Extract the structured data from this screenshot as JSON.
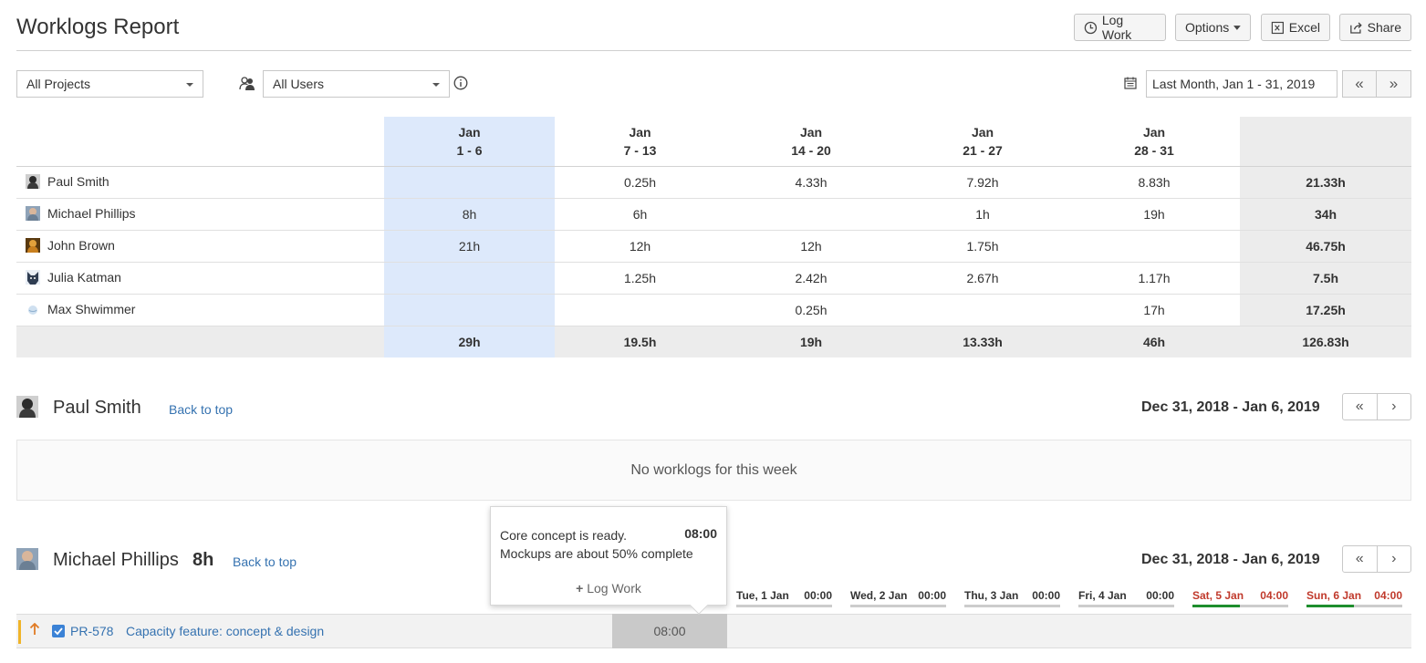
{
  "page": {
    "title": "Worklogs Report"
  },
  "toolbar": {
    "log_work": "Log Work",
    "options": "Options",
    "excel": "Excel",
    "share": "Share"
  },
  "filters": {
    "projects": "All Projects",
    "users": "All Users",
    "date_range": "Last Month, Jan 1 - 31, 2019",
    "prev": "«",
    "next": "»"
  },
  "summary": {
    "columns": [
      {
        "month": "Jan",
        "range": "1 - 6"
      },
      {
        "month": "Jan",
        "range": "7 - 13"
      },
      {
        "month": "Jan",
        "range": "14 - 20"
      },
      {
        "month": "Jan",
        "range": "21 - 27"
      },
      {
        "month": "Jan",
        "range": "28 - 31"
      }
    ],
    "rows": [
      {
        "name": "Paul Smith",
        "cells": [
          "",
          "0.25h",
          "4.33h",
          "7.92h",
          "8.83h"
        ],
        "total": "21.33h"
      },
      {
        "name": "Michael Phillips",
        "cells": [
          "8h",
          "6h",
          "",
          "1h",
          "19h"
        ],
        "total": "34h"
      },
      {
        "name": "John Brown",
        "cells": [
          "21h",
          "12h",
          "12h",
          "1.75h",
          ""
        ],
        "total": "46.75h"
      },
      {
        "name": "Julia Katman",
        "cells": [
          "",
          "1.25h",
          "2.42h",
          "2.67h",
          "1.17h"
        ],
        "total": "7.5h"
      },
      {
        "name": "Max Shwimmer",
        "cells": [
          "",
          "",
          "0.25h",
          "",
          "17h"
        ],
        "total": "17.25h"
      }
    ],
    "footer": {
      "cells": [
        "29h",
        "19.5h",
        "19h",
        "13.33h",
        "46h"
      ],
      "total": "126.83h"
    }
  },
  "sections": {
    "paul": {
      "name": "Paul Smith",
      "back_to_top": "Back to top",
      "week": "Dec 31, 2018 - Jan 6, 2019",
      "empty": "No worklogs for this week",
      "prev": "«",
      "next": "›"
    },
    "michael": {
      "name": "Michael Phillips",
      "hours": "8h",
      "back_to_top": "Back to top",
      "week": "Dec 31, 2018 - Jan 6, 2019",
      "prev": "«",
      "next": "›",
      "days": [
        {
          "label": "Tue, 1 Jan",
          "time": "00:00"
        },
        {
          "label": "Wed, 2 Jan",
          "time": "00:00"
        },
        {
          "label": "Thu, 3 Jan",
          "time": "00:00"
        },
        {
          "label": "Fri, 4 Jan",
          "time": "00:00"
        },
        {
          "label": "Sat, 5 Jan",
          "time": "04:00"
        },
        {
          "label": "Sun, 6 Jan",
          "time": "04:00"
        }
      ],
      "issue": {
        "key": "PR-578",
        "summary": "Capacity feature: concept & design",
        "cell": "08:00"
      },
      "popover": {
        "line1": "Core concept is ready.",
        "line2": "Mockups are about 50% complete",
        "time": "08:00",
        "log_work": "Log Work"
      }
    }
  },
  "colors": {
    "link": "#3572b0",
    "highlight": "#dde9fb",
    "weekend": "#c0392b",
    "logged": "#1e8e2d"
  }
}
